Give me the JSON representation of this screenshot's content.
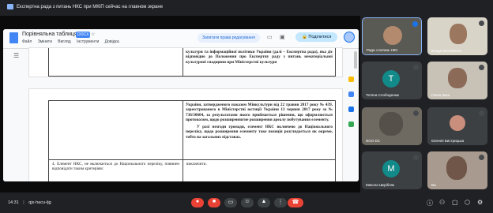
{
  "banner": {
    "text": "Експертна рада з питань НКС при МКІП сейчас на главном экране"
  },
  "doc": {
    "title": "Порівняльна таблиця",
    "badge": "DOCX",
    "menus": [
      "Файл",
      "Змінити",
      "Вигляд",
      "Інструменти",
      "Довідка"
    ],
    "request_button": "Запитати права редагування",
    "share_button": "Поділитися",
    "page1_text": "культури та інформаційної політики України (далі – Експертна рада), яка діє відповідно до Положення про Експертну раду з питань нематеріальної культурної спадщини при Міністерстві культури",
    "page2_right_text": "України, затвердженого наказом Мінкультури від 22 травня 2017 року № 439, зареєстрованого в Міністерстві юстиції України 13 червня 2017 року за № 736/30604, за результатами якого приймається рішення, що оформлюється протоколом, щодо розширення/не розширення ареалу побутування елементу.",
    "page2_right_text2": "У разі незгоди громади, елемент НКС включено до Національного переліку, щодо розширення елементу таке позиція розглядається як окреме, тобто на загальних підставах.",
    "page2_left_text": "4. Елемент НКС, не включається до Національного переліку, повинен відповідати таким критеріям:",
    "page2_bottom_right": "виключити."
  },
  "participants": [
    {
      "name": "Рада з питань НКС"
    },
    {
      "name": "Влада Литовченко"
    },
    {
      "name": "Тетяна Слободенюк",
      "initial": "Т"
    },
    {
      "name": "Ганна Іваш"
    },
    {
      "name": "NGO DC"
    },
    {
      "name": "Євгенія Бистрицька"
    },
    {
      "name": "Микола Шкрібляк",
      "initial": "M"
    },
    {
      "name": "Вы"
    }
  ],
  "bottom": {
    "time": "14:31",
    "meeting_code": "qjx-hacu-tjg"
  },
  "colors": {
    "background": "#202124",
    "tile": "#3c4043",
    "end_call": "#ea4335",
    "accent": "#1a73e8",
    "avatar_teal": "#128a8a"
  }
}
